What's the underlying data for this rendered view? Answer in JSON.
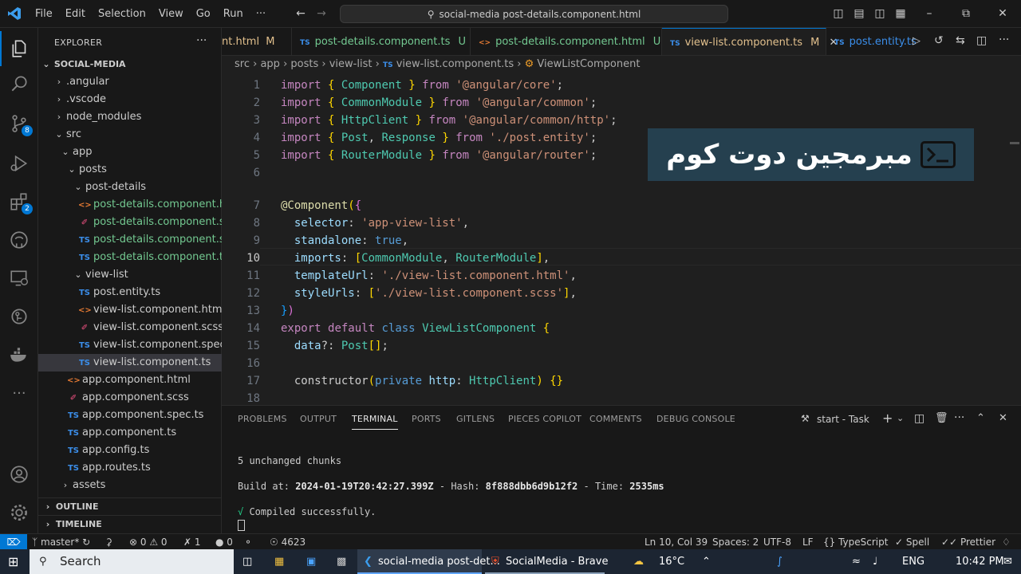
{
  "titlebar": {
    "menu": [
      "File",
      "Edit",
      "Selection",
      "View",
      "Go",
      "Run",
      "···"
    ],
    "search": "social-media post-details.component.html"
  },
  "activity_badges": {
    "source_control": "8",
    "extensions": "2"
  },
  "sidebar": {
    "title": "EXPLORER",
    "project": "SOCIAL-MEDIA",
    "items": [
      {
        "label": ".angular",
        "icon": "chevron-right"
      },
      {
        "label": ".vscode",
        "icon": "chevron-right"
      },
      {
        "label": "node_modules",
        "icon": "chevron-right"
      },
      {
        "label": "src",
        "icon": "chevron-down"
      },
      {
        "label": "app",
        "icon": "chevron-down"
      },
      {
        "label": "posts",
        "icon": "chevron-down"
      },
      {
        "label": "post-details",
        "icon": "chevron-down"
      },
      {
        "label": "post-details.component.ht...",
        "icon": "html"
      },
      {
        "label": "post-details.component.scss",
        "icon": "scss"
      },
      {
        "label": "post-details.component.sp...",
        "icon": "TS"
      },
      {
        "label": "post-details.component.ts",
        "icon": "TS"
      },
      {
        "label": "view-list",
        "icon": "chevron-down"
      },
      {
        "label": "post.entity.ts",
        "icon": "TS"
      },
      {
        "label": "view-list.component.html",
        "icon": "html"
      },
      {
        "label": "view-list.component.scss",
        "icon": "scss"
      },
      {
        "label": "view-list.component.spec.ts",
        "icon": "TS"
      },
      {
        "label": "view-list.component.ts",
        "icon": "TS"
      },
      {
        "label": "app.component.html",
        "icon": "html"
      },
      {
        "label": "app.component.scss",
        "icon": "scss"
      },
      {
        "label": "app.component.spec.ts",
        "icon": "TS"
      },
      {
        "label": "app.component.ts",
        "icon": "TS"
      },
      {
        "label": "app.config.ts",
        "icon": "TS"
      },
      {
        "label": "app.routes.ts",
        "icon": "TS"
      },
      {
        "label": "assets",
        "icon": "chevron-right"
      }
    ],
    "outline": "OUTLINE",
    "timeline": "TIMELINE"
  },
  "tabs": [
    {
      "label": "nt.html",
      "status": "M"
    },
    {
      "label": "post-details.component.ts",
      "status": "U",
      "icon": "TS"
    },
    {
      "label": "post-details.component.html",
      "status": "U"
    },
    {
      "label": "view-list.component.ts",
      "status": "M",
      "icon": "TS"
    },
    {
      "label": "post.entity.ts",
      "icon": "TS"
    }
  ],
  "breadcrumb": [
    "src",
    "app",
    "posts",
    "view-list",
    "view-list.component.ts",
    "ViewListComponent"
  ],
  "overlay_text": "مبرمجين دوت كوم",
  "editor": {
    "current_line": 10,
    "lines": [
      {
        "n": "1",
        "code": "import { Component } from '@angular/core';"
      },
      {
        "n": "2",
        "code": "import { CommonModule } from '@angular/common';"
      },
      {
        "n": "3",
        "code": "import { HttpClient } from '@angular/common/http';"
      },
      {
        "n": "4",
        "code": "import { Post, Response } from './post.entity';"
      },
      {
        "n": "5",
        "code": "import { RouterModule } from '@angular/router';"
      },
      {
        "n": "6",
        "code": ""
      },
      {
        "n": "7",
        "code": "@Component({"
      },
      {
        "n": "8",
        "code": "  selector: 'app-view-list',"
      },
      {
        "n": "9",
        "code": "  standalone: true,"
      },
      {
        "n": "10",
        "code": "  imports: [CommonModule, RouterModule],"
      },
      {
        "n": "11",
        "code": "  templateUrl: './view-list.component.html',"
      },
      {
        "n": "12",
        "code": "  styleUrls: ['./view-list.component.scss'],"
      },
      {
        "n": "13",
        "code": "})"
      },
      {
        "n": "14",
        "code": "export default class ViewListComponent {"
      },
      {
        "n": "15",
        "code": "  data?: Post[];"
      },
      {
        "n": "16",
        "code": ""
      },
      {
        "n": "17",
        "code": "  constructor(private http: HttpClient) {}"
      },
      {
        "n": "18",
        "code": ""
      }
    ]
  },
  "panel": {
    "tabs": [
      "PROBLEMS",
      "OUTPUT",
      "TERMINAL",
      "PORTS",
      "GITLENS",
      "PIECES COPILOT",
      "COMMENTS",
      "DEBUG CONSOLE"
    ],
    "task": "start - Task",
    "terminal": [
      "5 unchanged chunks",
      "Build at: 2024-01-19T20:42:27.399Z - Hash: 8f888dbb6d9b12f2 - Time: 2535ms",
      "√ Compiled successfully."
    ]
  },
  "statusbar": {
    "branch": "master*",
    "errors": "0",
    "warnings": "0",
    "ports": "1",
    "radio": "0",
    "eye": "4623",
    "position": "Ln 10, Col 39",
    "spaces": "Spaces: 2",
    "encoding": "UTF-8",
    "eol": "LF",
    "language": "TypeScript",
    "spell": "Spell",
    "prettier": "Prettier"
  },
  "taskbar": {
    "search": "Search",
    "app1": "social-media post-det...",
    "app2": "SocialMedia - Brave",
    "weather": "16°C",
    "lang": "ENG",
    "time": "10:42 PM"
  }
}
